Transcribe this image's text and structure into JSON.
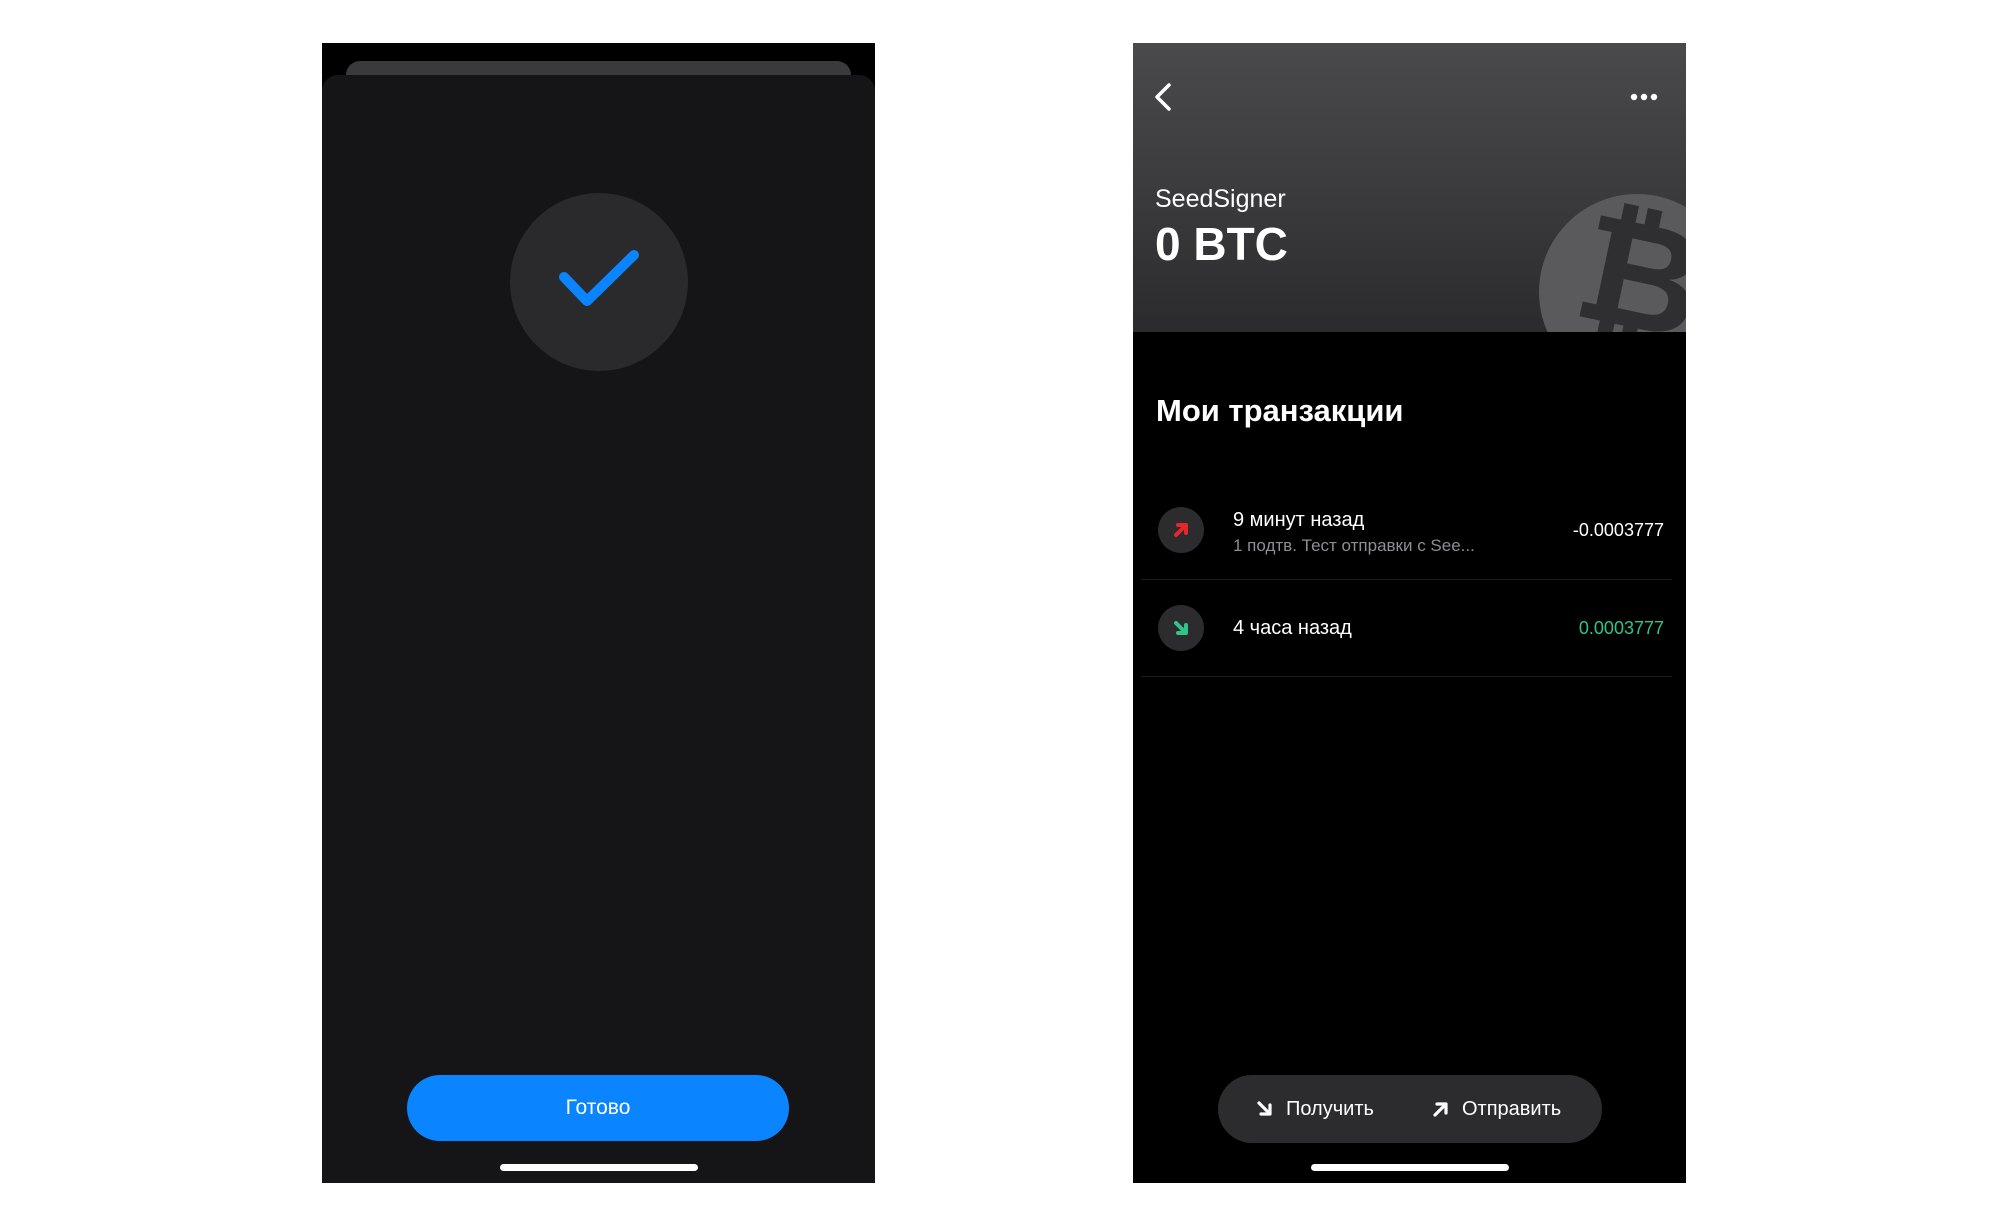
{
  "left_screen": {
    "done_label": "Готово"
  },
  "right_screen": {
    "wallet_name": "SeedSigner",
    "balance": "0 BTC",
    "coin_symbol": "₿",
    "section_title": "Мои транзакции",
    "transactions": [
      {
        "time": "9 минут назад",
        "subtitle": "1 подтв. Тест отправки с See...",
        "amount": "-0.0003777",
        "direction": "outgoing",
        "icon": "arrow-up-right-icon",
        "color": "#e5262d",
        "amount_color": "#ffffff"
      },
      {
        "time": "4 часа назад",
        "subtitle": "",
        "amount": "0.0003777",
        "direction": "incoming",
        "icon": "arrow-down-right-icon",
        "color": "#2fc489",
        "amount_color": "#2fc489"
      }
    ],
    "actions": {
      "receive_label": "Получить",
      "send_label": "Отправить"
    }
  },
  "colors": {
    "accent": "#0a84ff",
    "check": "#0a84ff",
    "incoming": "#2fc489",
    "outgoing": "#e5262d"
  }
}
